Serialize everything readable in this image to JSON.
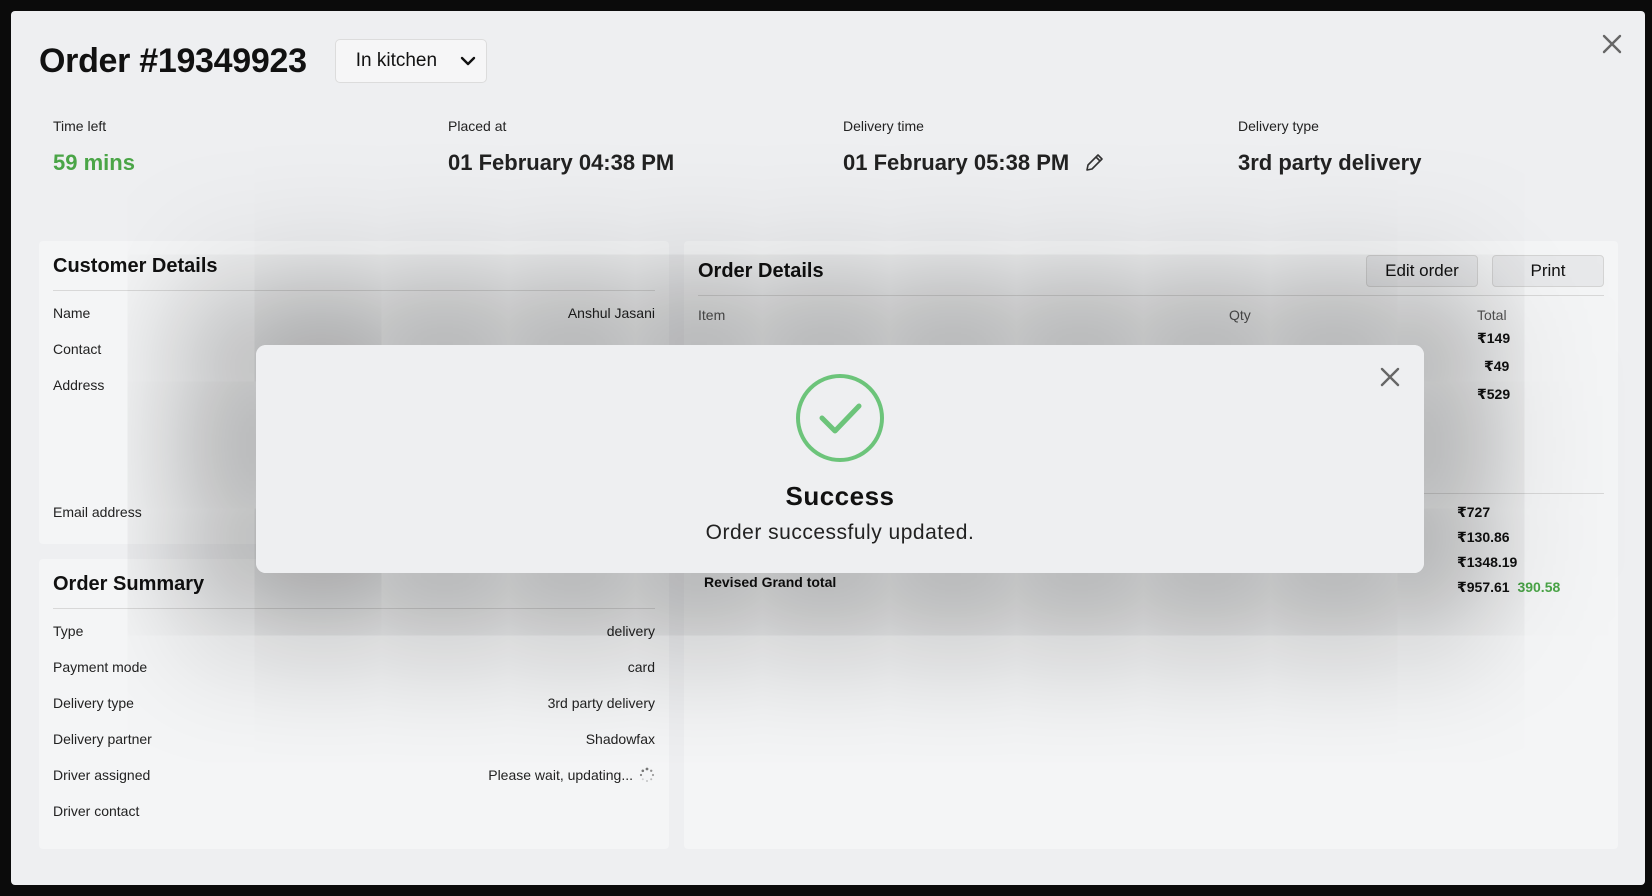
{
  "order": {
    "title": "Order #19349923",
    "status": "In kitchen",
    "status_options": [
      "In kitchen"
    ]
  },
  "meta": {
    "time_left_label": "Time left",
    "time_left": "59 mins",
    "placed_label": "Placed at",
    "placed": "01 February 04:38 PM",
    "delivery_time_label": "Delivery time",
    "delivery_time": "01 February 05:38 PM",
    "delivery_type_label": "Delivery type",
    "delivery_type": "3rd party delivery"
  },
  "customer": {
    "heading": "Customer Details",
    "name_label": "Name",
    "name": "Anshul Jasani",
    "contact_label": "Contact",
    "address_label": "Address",
    "email_label": "Email address"
  },
  "summary": {
    "heading": "Order Summary",
    "rows": [
      {
        "label": "Type",
        "value": "delivery"
      },
      {
        "label": "Payment mode",
        "value": "card"
      },
      {
        "label": "Delivery type",
        "value": "3rd party delivery"
      },
      {
        "label": "Delivery partner",
        "value": "Shadowfax"
      },
      {
        "label": "Driver assigned",
        "value": "Please wait, updating..."
      },
      {
        "label": "Driver contact",
        "value": ""
      }
    ]
  },
  "details": {
    "heading": "Order Details",
    "edit_label": "Edit order",
    "print_label": "Print",
    "col_item": "Item",
    "col_qty": "Qty",
    "col_total": "Total",
    "item_totals": [
      "₹149",
      "₹49",
      "₹529"
    ],
    "sum_values": [
      "₹727",
      "₹130.86",
      "₹1348.19"
    ],
    "revised_label": "Revised Grand total",
    "revised_value": "₹957.61",
    "revised_diff": "390.58"
  },
  "modal": {
    "title": "Success",
    "message": "Order successfuly updated."
  },
  "colors": {
    "accent_green": "#4aa547",
    "check_green": "#6cc47a"
  }
}
